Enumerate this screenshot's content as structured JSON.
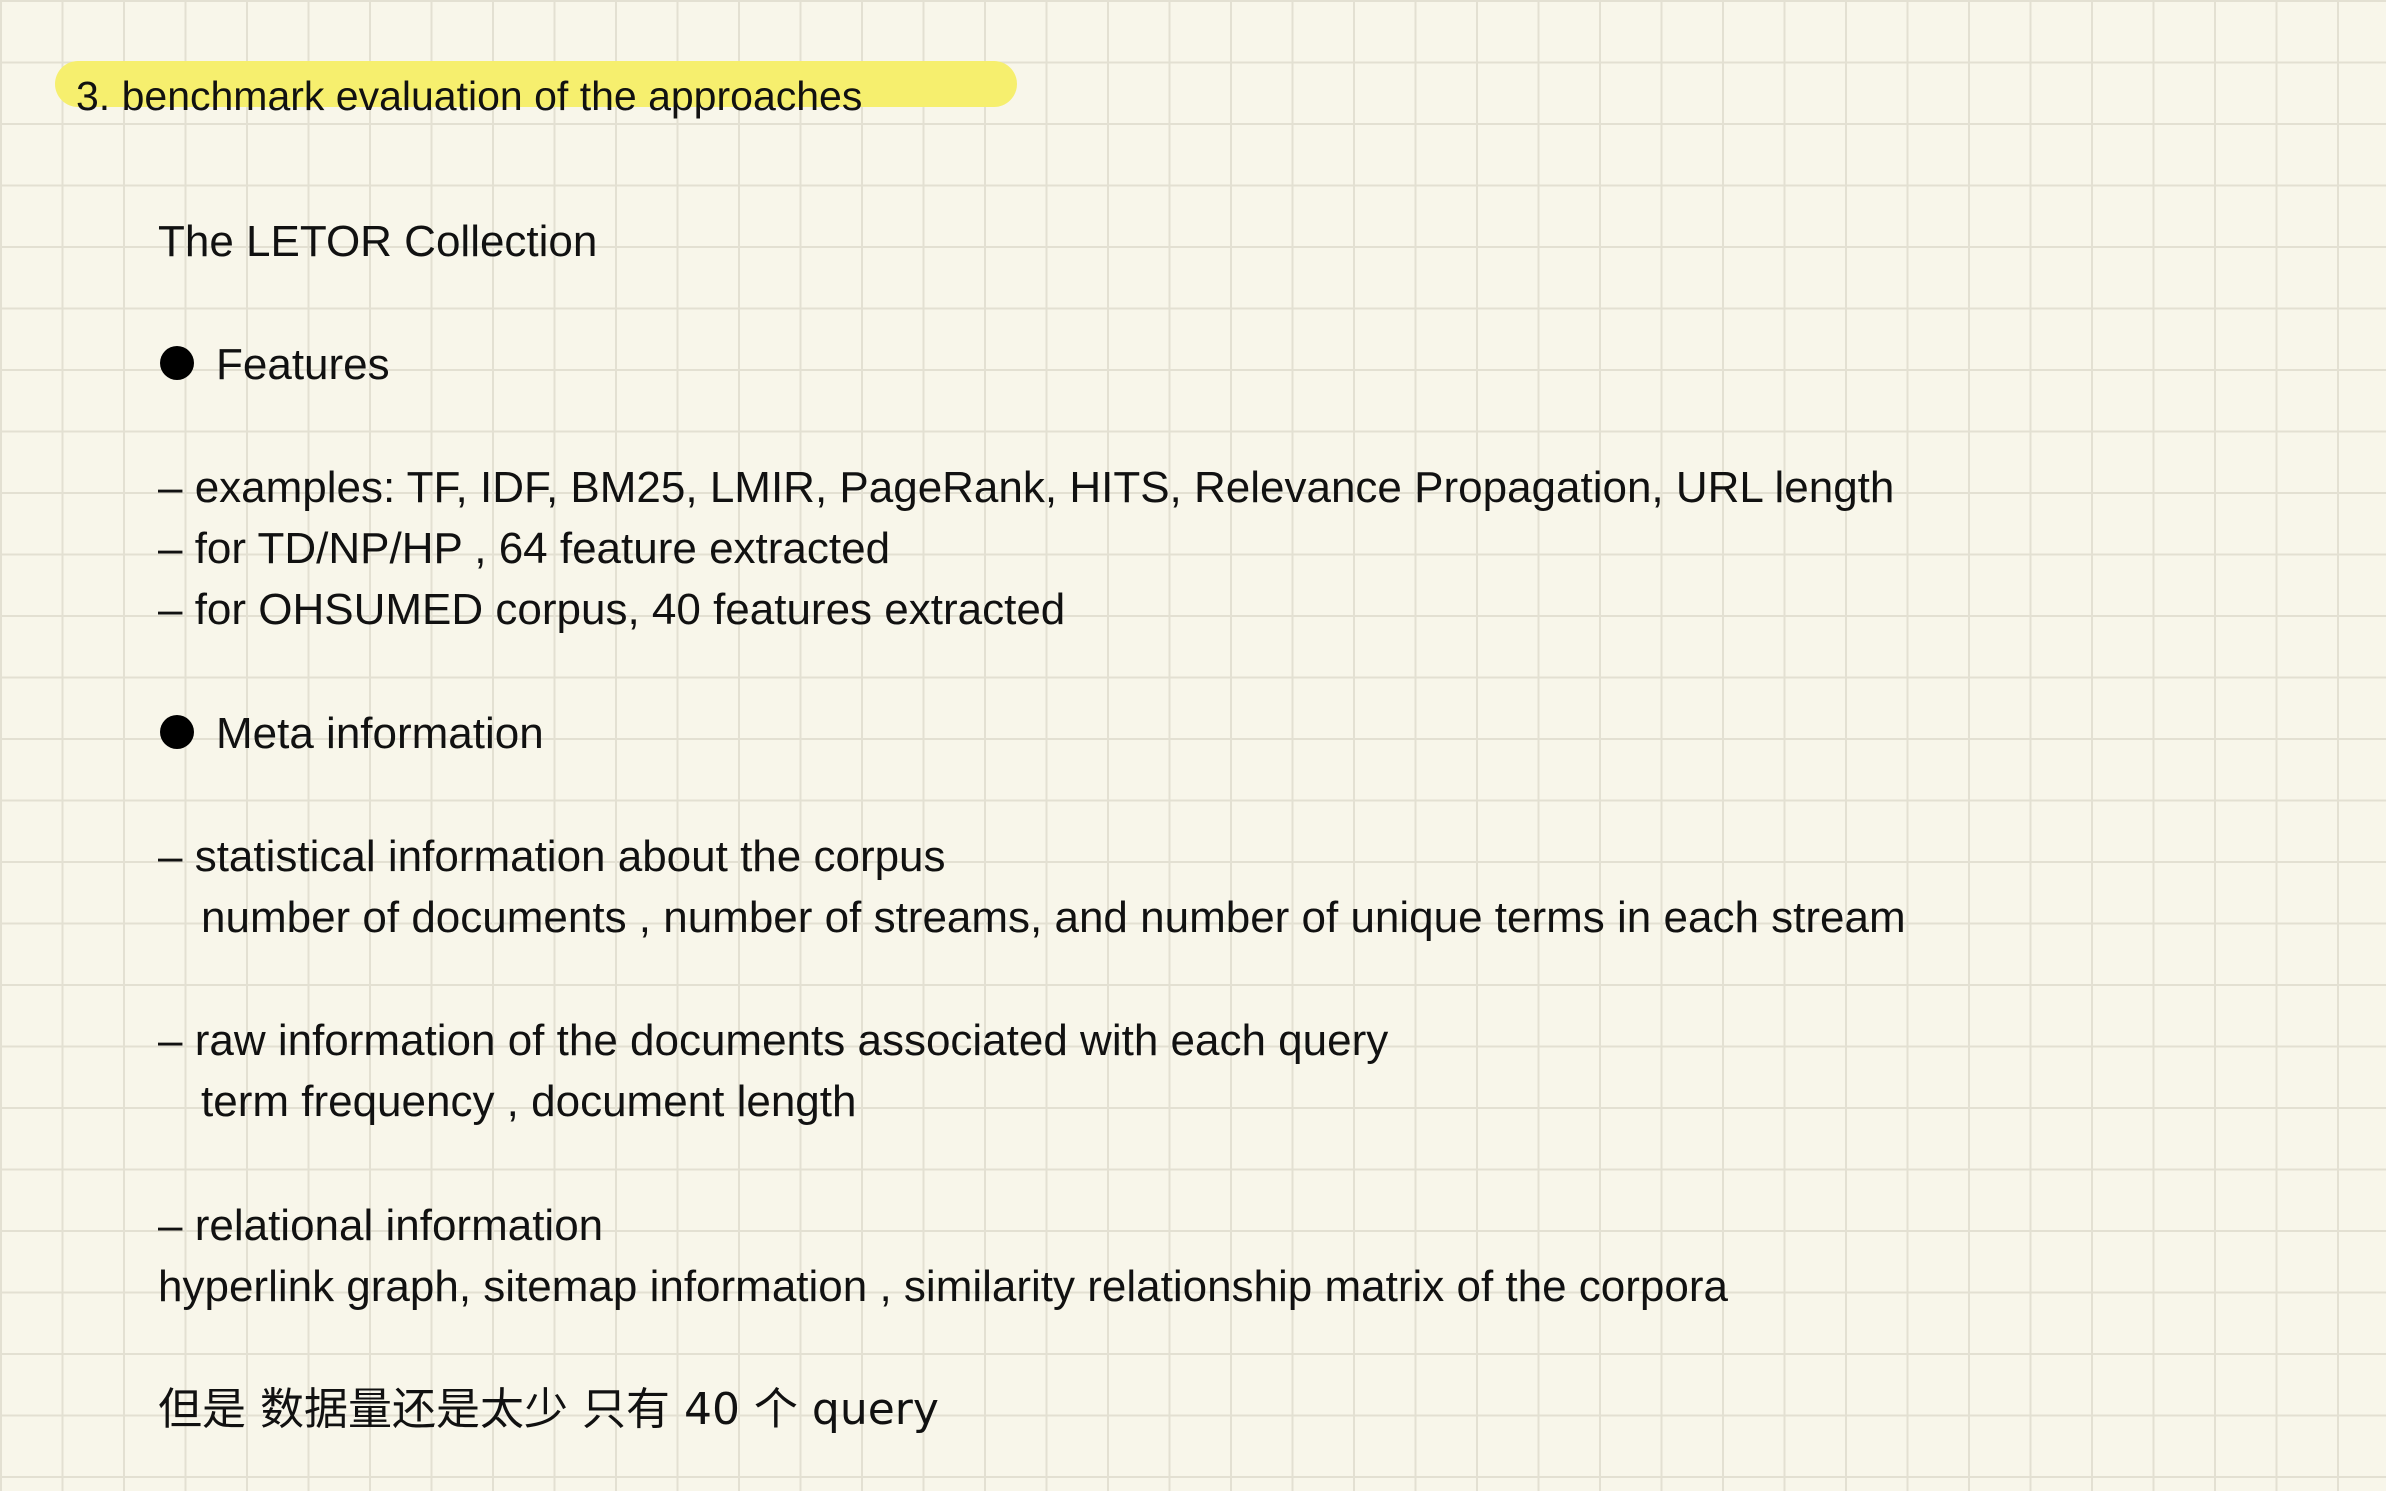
{
  "heading": "3. benchmark evaluation of the approaches",
  "highlight_color": "#f6ef6e",
  "collection_title": "The LETOR Collection",
  "sections": {
    "features": {
      "label": "Features",
      "items": [
        "– examples: TF, IDF, BM25, LMIR, PageRank, HITS, Relevance Propagation, URL length",
        "– for TD/NP/HP , 64 feature extracted",
        "– for OHSUMED corpus, 40 features extracted"
      ]
    },
    "meta": {
      "label": "Meta information",
      "statistical": {
        "title": "– statistical information about the corpus",
        "detail": "number of documents , number of streams, and number of unique terms in each stream"
      },
      "raw": {
        "title": "– raw information of the documents associated with each query",
        "detail": "term frequency , document length"
      },
      "relational": {
        "title": "– relational information",
        "detail": "hyperlink graph, sitemap information ,  similarity relationship matrix of the corpora"
      }
    }
  },
  "note": "但是 数据量还是太少 只有 40 个 query"
}
